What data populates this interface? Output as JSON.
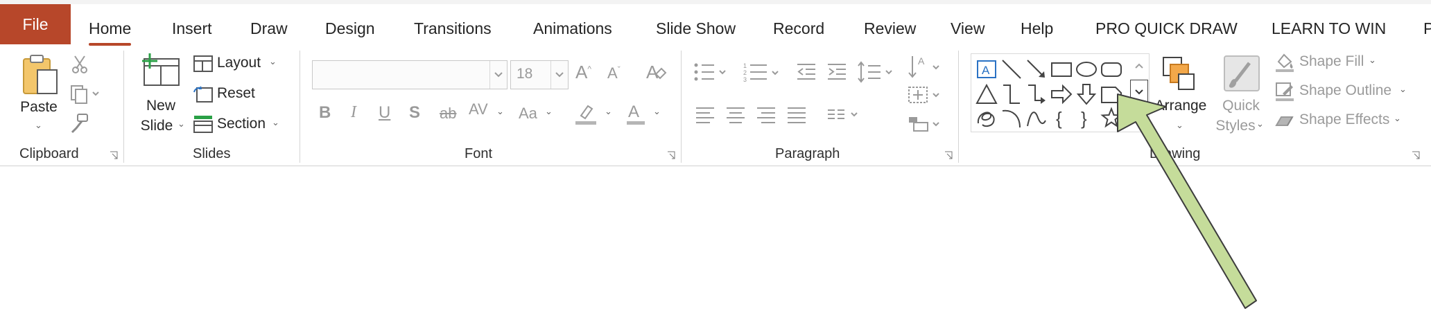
{
  "tabs": {
    "file": "File",
    "home": "Home",
    "insert": "Insert",
    "draw": "Draw",
    "design": "Design",
    "transitions": "Transitions",
    "animations": "Animations",
    "slide_show": "Slide Show",
    "record": "Record",
    "review": "Review",
    "view": "View",
    "help": "Help",
    "pro_quick_draw": "PRO QUICK DRAW",
    "learn_to_win": "LEARN TO WIN",
    "overflow": "P"
  },
  "clipboard": {
    "paste": "Paste",
    "group_label": "Clipboard"
  },
  "slides": {
    "new_line1": "New",
    "new_line2": "Slide",
    "layout": "Layout",
    "reset": "Reset",
    "section": "Section",
    "group_label": "Slides"
  },
  "font": {
    "font_name": "",
    "font_size": "18",
    "group_label": "Font"
  },
  "paragraph": {
    "group_label": "Paragraph"
  },
  "drawing": {
    "arrange": "Arrange",
    "quick_line1": "Quick",
    "quick_line2": "Styles",
    "shape_fill": "Shape Fill",
    "shape_outline": "Shape Outline",
    "shape_effects": "Shape Effects",
    "group_label": "Drawing"
  },
  "colors": {
    "accent": "#b7472a",
    "annotation_arrow": "#c5dc9a"
  }
}
